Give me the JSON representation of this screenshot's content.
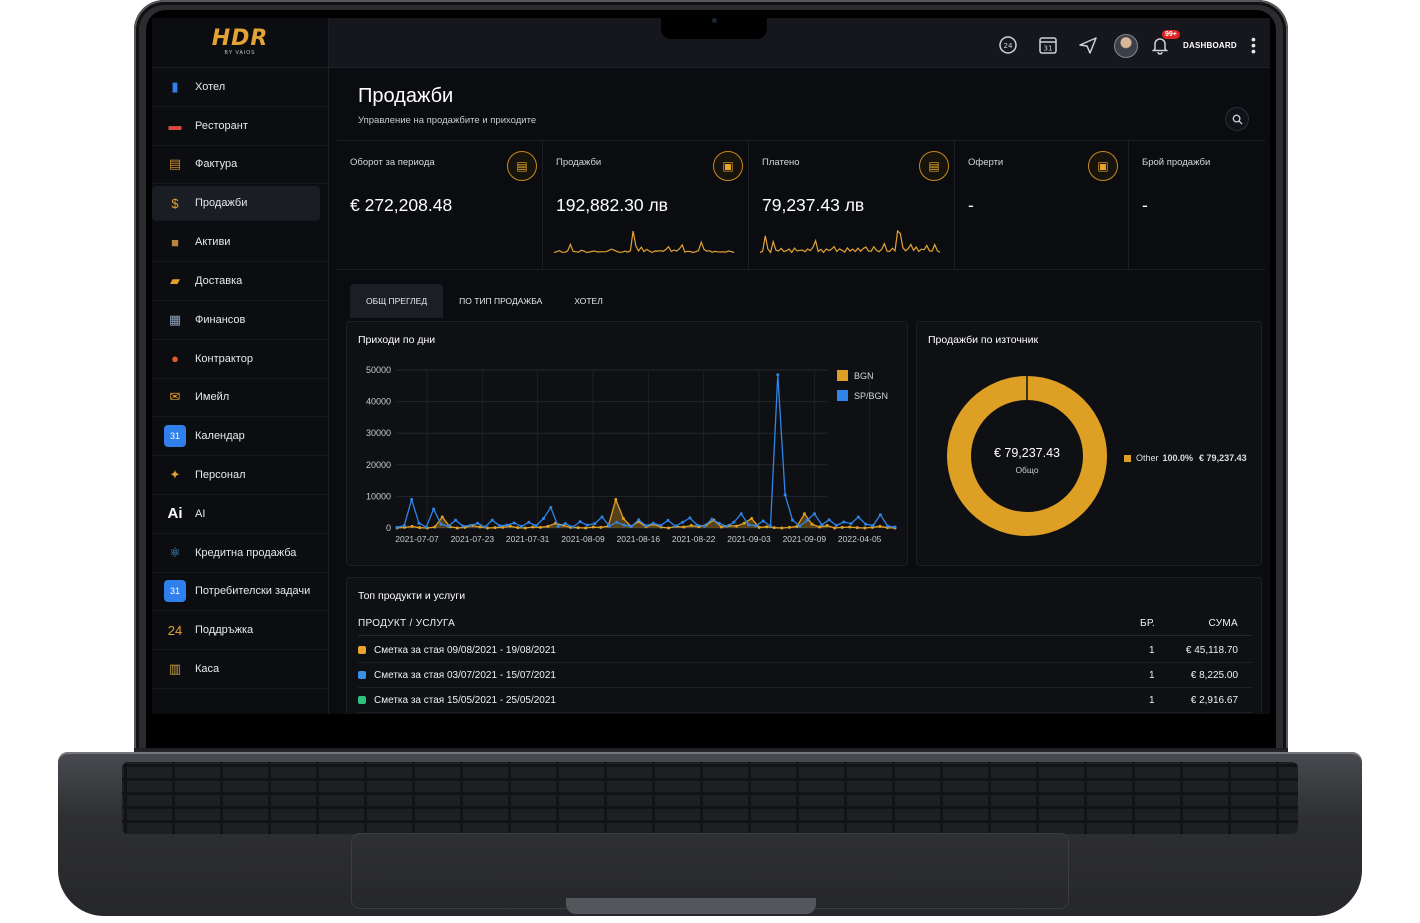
{
  "brand": {
    "logo": "HDR",
    "tagline": "BY VAIOS"
  },
  "sidebar": {
    "items": [
      {
        "label": "Хотел",
        "icon": "building-icon",
        "color": "#2f80ed"
      },
      {
        "label": "Ресторант",
        "icon": "restaurant-icon",
        "color": "#d94a3d"
      },
      {
        "label": "Фактура",
        "icon": "receipt-icon",
        "color": "#c98a2e"
      },
      {
        "label": "Продажби",
        "icon": "money-bag-icon",
        "color": "#e2a234",
        "active": true
      },
      {
        "label": "Активи",
        "icon": "box-icon",
        "color": "#b7843a"
      },
      {
        "label": "Доставка",
        "icon": "truck-icon",
        "color": "#e0a030"
      },
      {
        "label": "Финансов",
        "icon": "printer-icon",
        "color": "#8aa0b8"
      },
      {
        "label": "Контрактор",
        "icon": "person-icon",
        "color": "#e05a2a"
      },
      {
        "label": "Имейл",
        "icon": "mail-icon",
        "color": "#e8a230"
      },
      {
        "label": "Календар",
        "icon": "calendar-icon",
        "color": "#2f80ed"
      },
      {
        "label": "Персонал",
        "icon": "team-icon",
        "color": "#e0a030"
      },
      {
        "label": "AI",
        "icon": "ai-icon",
        "color": "#ffffff"
      },
      {
        "label": "Кредитна продажба",
        "icon": "react-icon",
        "color": "#4aa3df"
      },
      {
        "label": "Потребителски задачи",
        "icon": "calendar-icon",
        "color": "#2f80ed"
      },
      {
        "label": "Поддръжка",
        "icon": "support-24-icon",
        "color": "#e8a230"
      },
      {
        "label": "Каса",
        "icon": "cash-register-icon",
        "color": "#c9a34a"
      }
    ]
  },
  "topbar": {
    "icons": [
      "support-24-icon",
      "calendar-31-icon",
      "send-icon",
      "avatar",
      "bell-icon"
    ],
    "notification_badge": "99+",
    "calendar_day": "31",
    "support_label": "24",
    "dashboard_label": "DASHBOARD"
  },
  "page": {
    "title": "Продажби",
    "subtitle": "Управление на продажбите и приходите"
  },
  "stats": [
    {
      "label": "Оборот за периода",
      "value": "€ 272,208.48",
      "icon": "document-icon",
      "has_spark": true
    },
    {
      "label": "Продажби",
      "value": "192,882.30 лв",
      "icon": "clipboard-icon",
      "has_spark": true
    },
    {
      "label": "Платено",
      "value": "79,237.43 лв",
      "icon": "document-icon",
      "has_spark": true
    },
    {
      "label": "Оферти",
      "value": "-",
      "icon": "clipboard-icon",
      "has_spark": false
    },
    {
      "label": "Брой продажби",
      "value": "-",
      "has_spark": false
    }
  ],
  "tabs": [
    "ОБЩ ПРЕГЛЕД",
    "ПО ТИП ПРОДАЖБА",
    "ХОТЕЛ"
  ],
  "revenue_chart": {
    "title": "Приходи по дни"
  },
  "source_chart": {
    "title": "Продажби по източник",
    "center_value": "€ 79,237.43",
    "center_label": "Общо",
    "legend": [
      {
        "name": "Other",
        "percent": "100.0%",
        "value": "€ 79,237.43",
        "color": "#dea024"
      }
    ]
  },
  "top_products": {
    "title": "Топ продукти и услуги",
    "columns": [
      "ПРОДУКТ / УСЛУГА",
      "БР.",
      "СУМА"
    ],
    "rows": [
      {
        "name": "Сметка за стая 09/08/2021 - 19/08/2021",
        "qty": "1",
        "sum": "€ 45,118.70",
        "color": "#e8a230"
      },
      {
        "name": "Сметка за стая 03/07/2021 - 15/07/2021",
        "qty": "1",
        "sum": "€ 8,225.00",
        "color": "#3a8ee6"
      },
      {
        "name": "Сметка за стая 15/05/2021 - 25/05/2021",
        "qty": "1",
        "sum": "€ 2,916.67",
        "color": "#2ec27e"
      }
    ]
  },
  "chart_data": [
    {
      "type": "line",
      "title": "Приходи по дни",
      "xlabel": "",
      "ylabel": "",
      "ylim": [
        0,
        50000
      ],
      "yticks": [
        0,
        10000,
        20000,
        30000,
        40000,
        50000
      ],
      "xtick_labels": [
        "2021-07-07",
        "2021-07-23",
        "2021-07-31",
        "2021-08-09",
        "2021-08-16",
        "2021-08-22",
        "2021-09-03",
        "2021-09-09",
        "2022-04-05"
      ],
      "grid": true,
      "legend_position": "top-right",
      "series": [
        {
          "name": "BGN",
          "color": "#dea024",
          "values": [
            0,
            200,
            500,
            100,
            0,
            300,
            3500,
            400,
            0,
            200,
            800,
            300,
            0,
            100,
            200,
            600,
            100,
            0,
            300,
            200,
            500,
            1500,
            900,
            200,
            100,
            0,
            300,
            200,
            600,
            9000,
            3000,
            500,
            2000,
            400,
            1200,
            300,
            0,
            500,
            300,
            800,
            400,
            1000,
            2500,
            300,
            800,
            600,
            1500,
            3000,
            200,
            400,
            100,
            0,
            200,
            500,
            4500,
            1200,
            300,
            800,
            0,
            200,
            300,
            100,
            0,
            200,
            500,
            100,
            0
          ]
        },
        {
          "name": "SP/BGN",
          "color": "#2f86e8",
          "values": [
            200,
            800,
            9000,
            1500,
            300,
            6000,
            1200,
            500,
            2500,
            600,
            800,
            1500,
            300,
            2500,
            700,
            900,
            1600,
            500,
            1800,
            700,
            3000,
            6500,
            500,
            1400,
            300,
            2000,
            900,
            1400,
            3500,
            600,
            1800,
            900,
            500,
            2600,
            700,
            1500,
            800,
            2400,
            600,
            1800,
            3200,
            900,
            600,
            2800,
            1500,
            500,
            1800,
            4500,
            1000,
            700,
            2200,
            600,
            48500,
            10500,
            2500,
            600,
            2400,
            4500,
            1000,
            2600,
            800,
            1900,
            1400,
            3500,
            1200,
            800,
            4200,
            600,
            300
          ]
        }
      ]
    },
    {
      "type": "pie",
      "title": "Продажби по източник",
      "categories": [
        "Other"
      ],
      "values": [
        79237.43
      ]
    }
  ]
}
